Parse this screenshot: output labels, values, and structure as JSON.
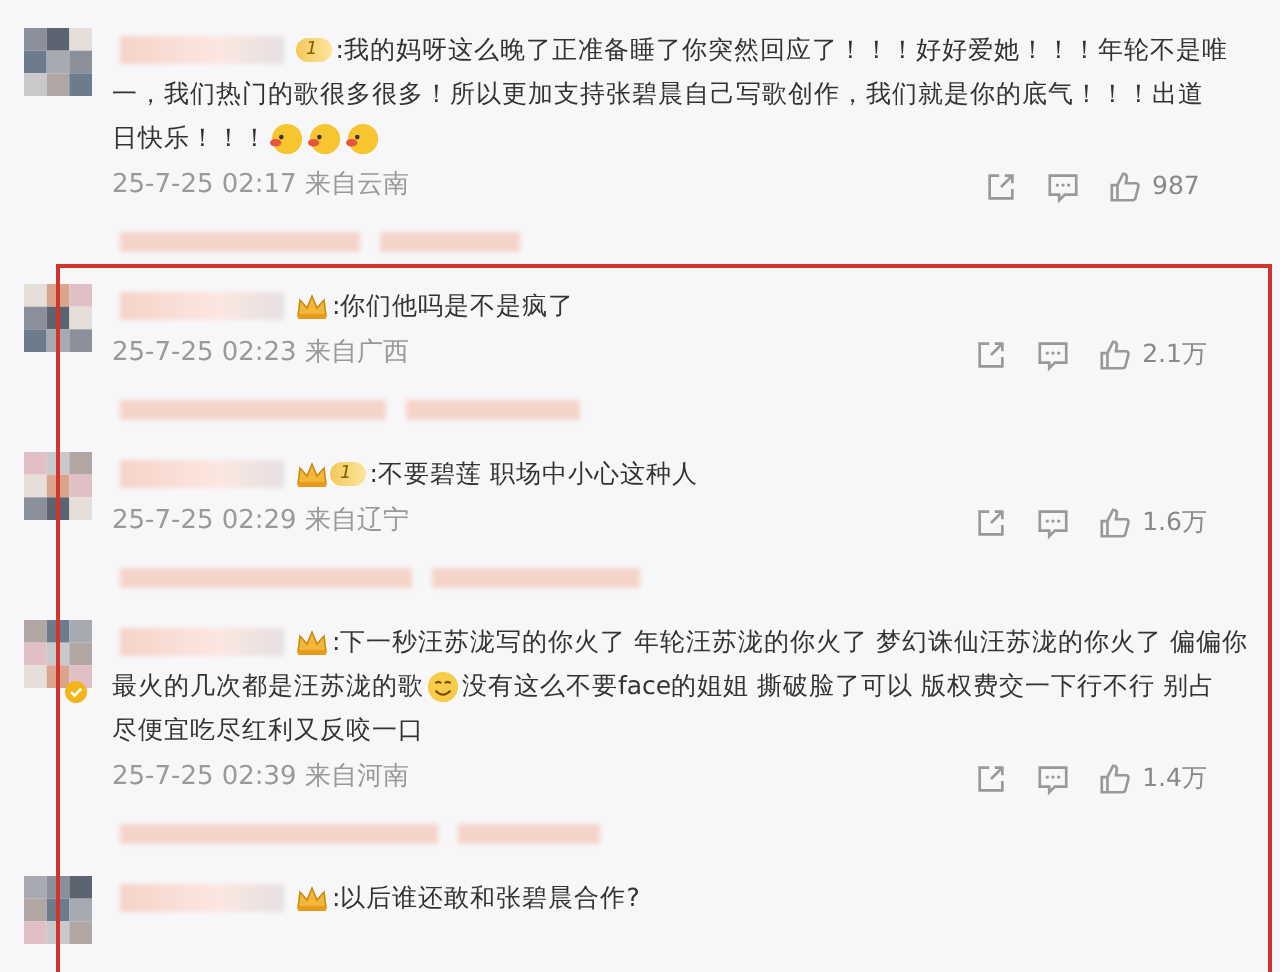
{
  "comments": [
    {
      "highlighted": false,
      "verified": false,
      "badge": {
        "kind": "level",
        "label": "1"
      },
      "lines": [
        [
          {
            "kind": "text",
            "text": ":我的妈呀这么晚了正准备睡了你突然回应了！！！好好爱她！！！年轮不是唯"
          }
        ],
        [
          {
            "kind": "text",
            "text": "一，我们热门的歌很多很多！所以更加支持张碧晨自己写歌创作，我们就是你的底气！！！出道"
          }
        ],
        [
          {
            "kind": "text",
            "text": "日快乐！！！"
          },
          {
            "kind": "duck"
          },
          {
            "kind": "duck"
          },
          {
            "kind": "duck"
          }
        ]
      ],
      "time": "25-7-25 02:17",
      "location": "来自云南",
      "likes": "987"
    },
    {
      "highlighted": true,
      "verified": false,
      "badge": {
        "kind": "crown"
      },
      "lines": [
        [
          {
            "kind": "text",
            "text": ":你们他吗是不是疯了"
          }
        ]
      ],
      "time": "25-7-25 02:23",
      "location": "来自广西",
      "likes": "2.1万"
    },
    {
      "highlighted": true,
      "verified": false,
      "badge": {
        "kind": "crownlevel",
        "label": "1"
      },
      "lines": [
        [
          {
            "kind": "text",
            "text": ":不要碧莲 职场中小心这种人"
          }
        ]
      ],
      "time": "25-7-25 02:29",
      "location": "来自辽宁",
      "likes": "1.6万"
    },
    {
      "highlighted": true,
      "verified": true,
      "badge": {
        "kind": "crown"
      },
      "lines": [
        [
          {
            "kind": "text",
            "text": ":下一秒汪苏泷写的你火了 年轮汪苏泷的你火了 梦幻诛仙汪苏泷的你火了 偏偏你"
          }
        ],
        [
          {
            "kind": "text",
            "text": "最火的几次都是汪苏泷的歌"
          },
          {
            "kind": "smile"
          },
          {
            "kind": "text",
            "text": "没有这么不要face的姐姐 撕破脸了可以 版权费交一下行不行 别占"
          }
        ],
        [
          {
            "kind": "text",
            "text": "尽便宜吃尽红利又反咬一口"
          }
        ]
      ],
      "time": "25-7-25 02:39",
      "location": "来自河南",
      "likes": "1.4万"
    },
    {
      "highlighted": true,
      "verified": false,
      "badge": {
        "kind": "crown"
      },
      "lines": [
        [
          {
            "kind": "text",
            "text": ":以后谁还敢和张碧晨合作?"
          }
        ]
      ]
    }
  ]
}
